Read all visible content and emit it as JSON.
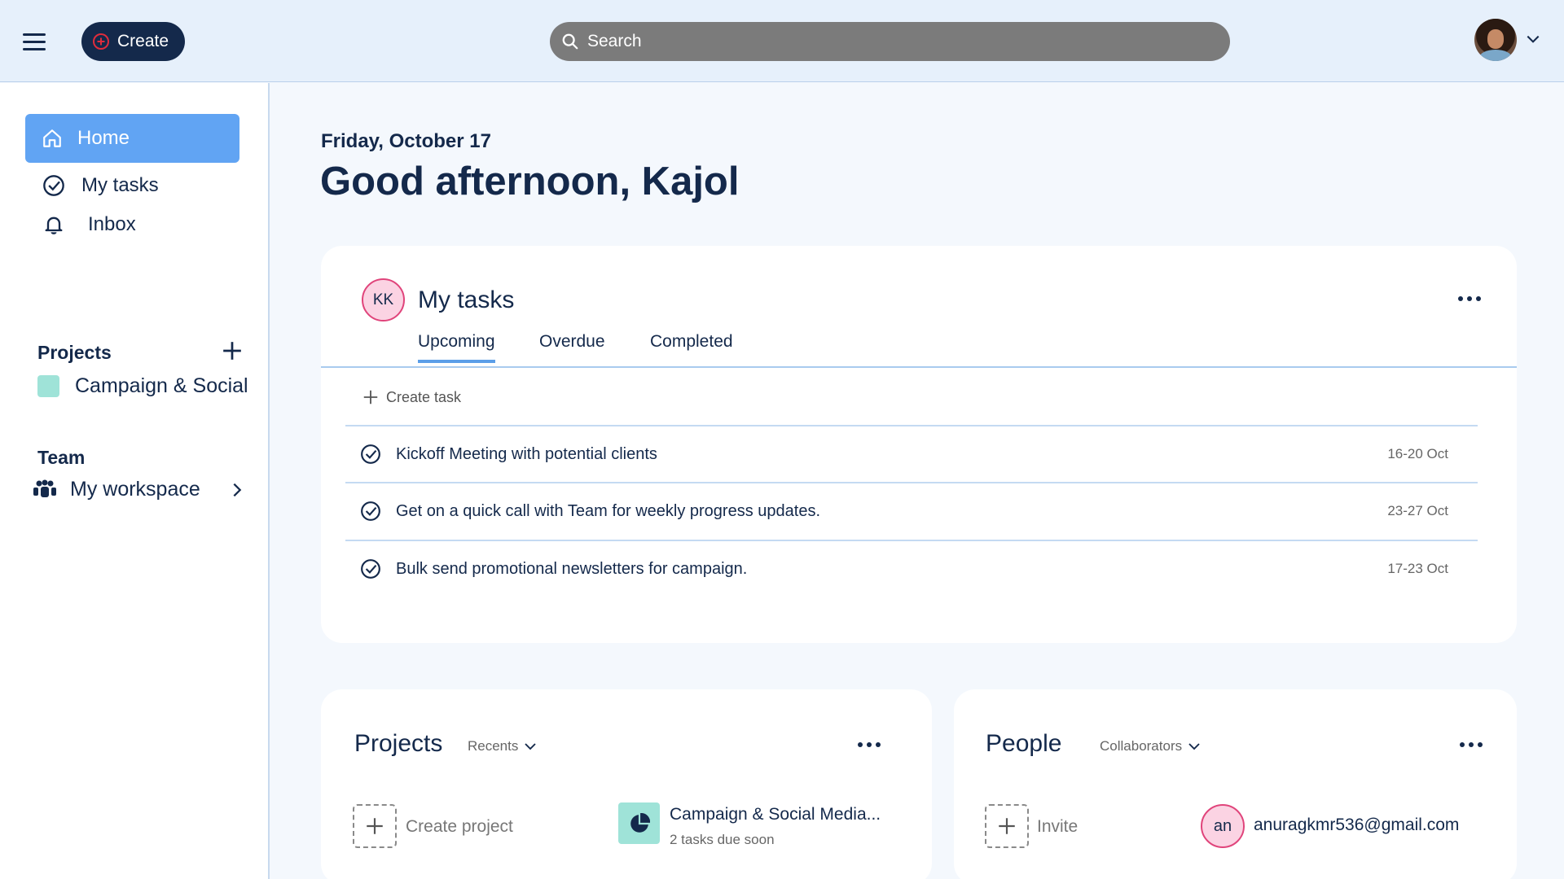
{
  "topbar": {
    "create_label": "Create",
    "search_placeholder": "Search"
  },
  "sidebar": {
    "home_label": "Home",
    "my_tasks_label": "My tasks",
    "inbox_label": "Inbox",
    "projects_title": "Projects",
    "projects": [
      {
        "label": "Campaign & Social",
        "color": "#9fe3d8"
      }
    ],
    "team_title": "Team",
    "workspace_label": "My workspace"
  },
  "main": {
    "date": "Friday, October 17",
    "greeting": "Good afternoon, Kajol"
  },
  "tasks_card": {
    "avatar_initials": "KK",
    "title": "My tasks",
    "tabs": [
      {
        "label": "Upcoming",
        "active": true
      },
      {
        "label": "Overdue",
        "active": false
      },
      {
        "label": "Completed",
        "active": false
      }
    ],
    "create_task_label": "Create task",
    "tasks": [
      {
        "title": "Kickoff Meeting with potential clients",
        "dates": "16-20 Oct"
      },
      {
        "title": "Get on a quick call with Team for weekly progress updates.",
        "dates": "23-27 Oct"
      },
      {
        "title": "Bulk send promotional newsletters for campaign.",
        "dates": "17-23 Oct"
      }
    ]
  },
  "projects_card": {
    "title": "Projects",
    "filter": "Recents",
    "create_label": "Create project",
    "project_name": "Campaign & Social Media...",
    "project_sub": "2 tasks due soon"
  },
  "people_card": {
    "title": "People",
    "filter": "Collaborators",
    "invite_label": "Invite",
    "person_initials": "an",
    "person_email": "anuragkmr536@gmail.com"
  },
  "colors": {
    "accent": "#61a4f3",
    "navy": "#14294b",
    "project": "#9fe3d8",
    "avatar_pink": "#fbd3e3"
  }
}
